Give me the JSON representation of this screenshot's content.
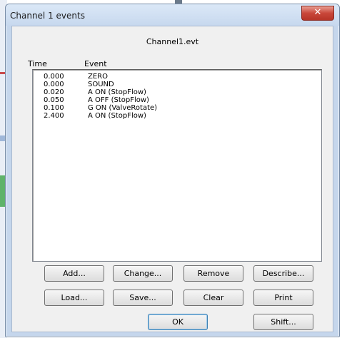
{
  "window": {
    "title": "Channel 1 events",
    "close_glyph": "✕"
  },
  "file": {
    "name": "Channel1.evt"
  },
  "columns": {
    "time": "Time",
    "event": "Event"
  },
  "events": [
    {
      "time": "0.000",
      "event": "ZERO"
    },
    {
      "time": "0.000",
      "event": "SOUND"
    },
    {
      "time": "0.020",
      "event": "A ON (StopFlow)"
    },
    {
      "time": "0.050",
      "event": "A OFF (StopFlow)"
    },
    {
      "time": "0.100",
      "event": "G ON (ValveRotate)"
    },
    {
      "time": "2.400",
      "event": "A ON (StopFlow)"
    }
  ],
  "buttons": {
    "add": "Add...",
    "change": "Change...",
    "remove": "Remove",
    "describe": "Describe...",
    "load": "Load...",
    "save": "Save...",
    "clear": "Clear",
    "print": "Print",
    "ok": "OK",
    "shift": "Shift..."
  },
  "colors": {
    "close_button": "#c9473a",
    "frame": "#c5d6ec"
  }
}
